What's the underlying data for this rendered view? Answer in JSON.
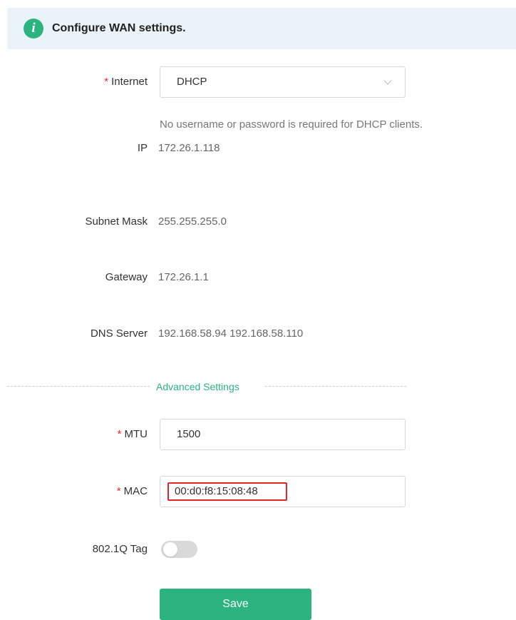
{
  "banner": {
    "icon": "info-icon",
    "text": "Configure WAN settings."
  },
  "form": {
    "internet": {
      "label": "Internet",
      "value": "DHCP",
      "hint": "No username or password is required for DHCP clients."
    },
    "ip": {
      "label": "IP",
      "value": "172.26.1.118"
    },
    "subnet_mask": {
      "label": "Subnet Mask",
      "value": "255.255.255.0"
    },
    "gateway": {
      "label": "Gateway",
      "value": "172.26.1.1"
    },
    "dns_server": {
      "label": "DNS Server",
      "value": "192.168.58.94 192.168.58.110"
    },
    "advanced_label": "Advanced Settings",
    "mtu": {
      "label": "MTU",
      "value": "1500"
    },
    "mac": {
      "label": "MAC",
      "value": "00:d0:f8:15:08:48"
    },
    "vlan_tag": {
      "label": "802.1Q Tag",
      "enabled": false
    },
    "required_mark": "*",
    "save_label": "Save"
  },
  "colors": {
    "accent": "#2bb47f",
    "banner_bg": "#ebf3fa",
    "highlight": "#e8242b",
    "required": "#f5222d"
  }
}
